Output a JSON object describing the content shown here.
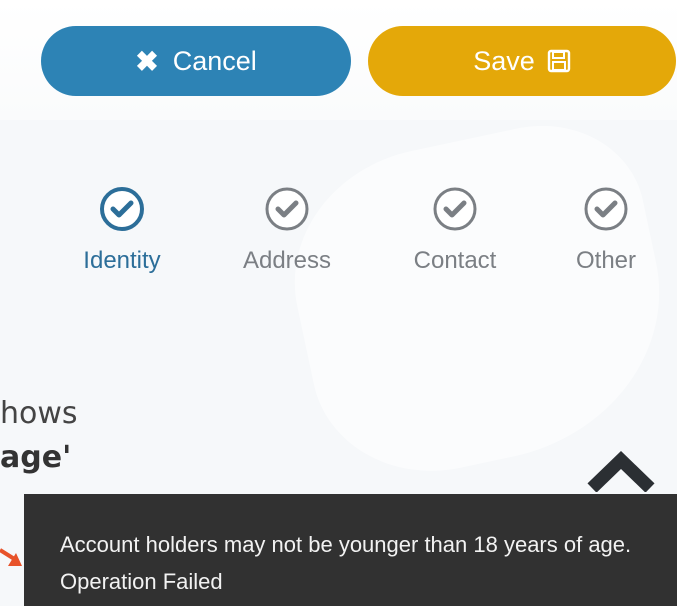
{
  "buttons": {
    "cancel_label": "Cancel",
    "save_label": "Save"
  },
  "steps": [
    {
      "label": "Identity",
      "active": true
    },
    {
      "label": "Address",
      "active": false
    },
    {
      "label": "Contact",
      "active": false
    },
    {
      "label": "Other",
      "active": false
    }
  ],
  "annotation": {
    "line1": "hows",
    "line2": "age'"
  },
  "toast": {
    "message": "Account holders may not be younger than 18 years of age. Operation Failed"
  },
  "colors": {
    "cancel": "#2d83b5",
    "save": "#e4a809",
    "active_step": "#2c6e99",
    "toast_bg": "#313131",
    "annotation_arrow": "#e8532a"
  }
}
